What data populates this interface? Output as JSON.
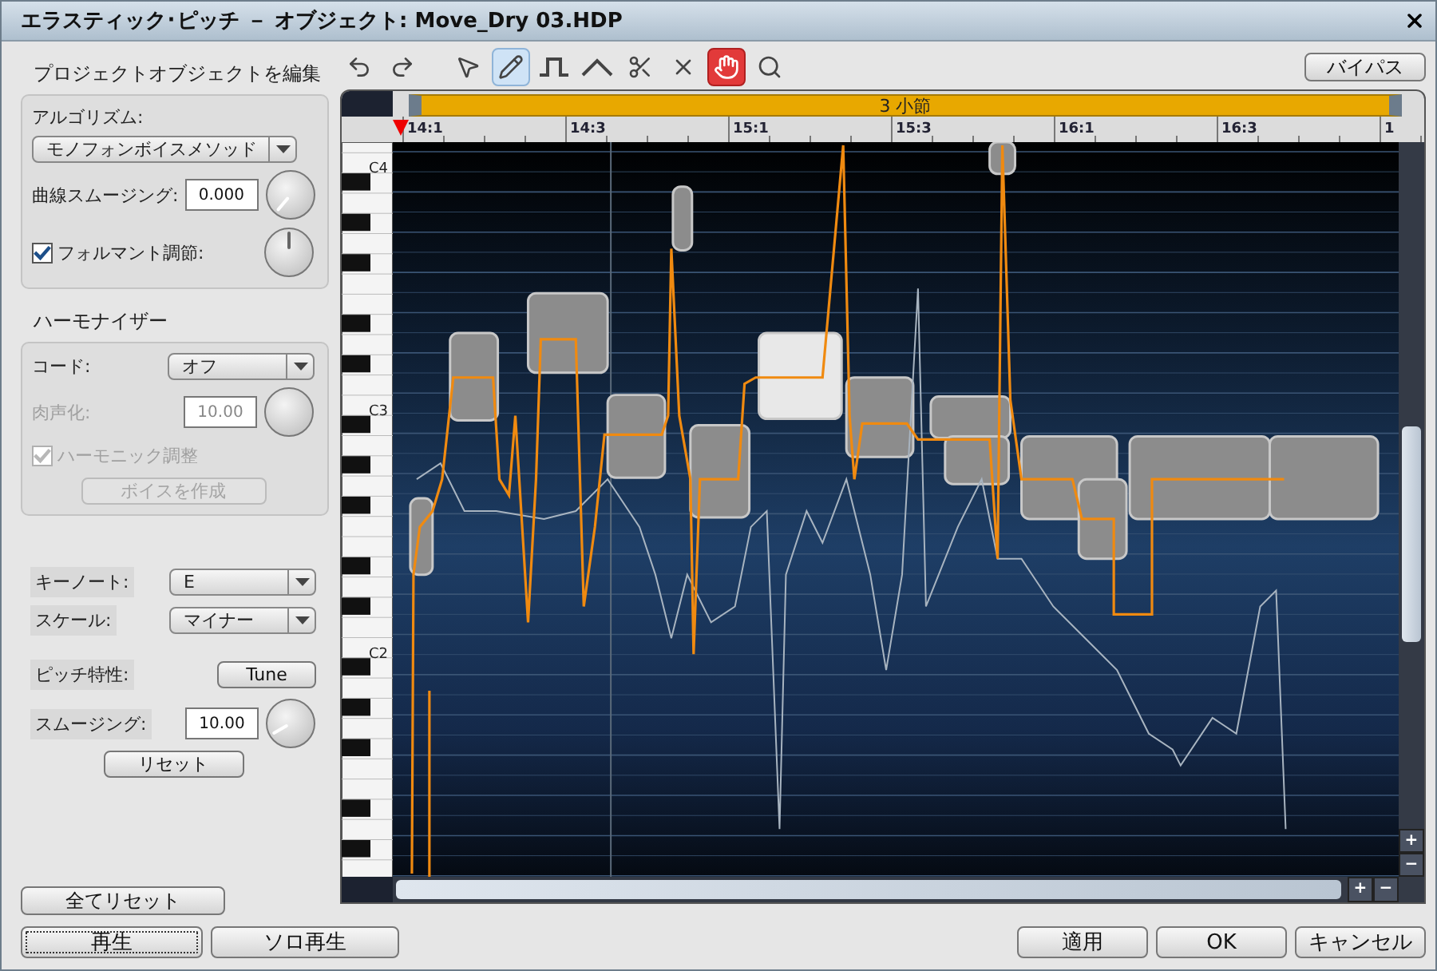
{
  "window": {
    "title": "エラスティック･ピッチ － オブジェクト: Move_Dry 03.HDP"
  },
  "toolbar": {
    "tools": [
      {
        "kind": "undo",
        "selected": false,
        "on": false
      },
      {
        "kind": "redo",
        "selected": false,
        "on": false
      },
      {
        "kind": "pointer",
        "selected": false,
        "on": false
      },
      {
        "kind": "pencil",
        "selected": true,
        "on": false
      },
      {
        "kind": "step",
        "selected": false,
        "on": false
      },
      {
        "kind": "ramp",
        "selected": false,
        "on": false
      },
      {
        "kind": "scissors",
        "selected": false,
        "on": false
      },
      {
        "kind": "delete",
        "selected": false,
        "on": false
      },
      {
        "kind": "hand",
        "selected": false,
        "on": true
      },
      {
        "kind": "zoom",
        "selected": false,
        "on": false
      }
    ],
    "bypass": "バイパス"
  },
  "edit_section": {
    "title": "プロジェクトオブジェクトを編集",
    "algorithm_label": "アルゴリズム:",
    "algorithm": "モノフォンボイスメソッド",
    "curve_smoothing": {
      "label": "曲線スムージング:",
      "value": "0.000"
    },
    "formant": {
      "label": "フォルマント調節:",
      "checked": true
    }
  },
  "harmonizer": {
    "title": "ハーモナイザー",
    "chord_label": "コード:",
    "chord": "オフ",
    "humanize": {
      "label": "肉声化:",
      "value": "10.00",
      "disabled": true
    },
    "harmonic": {
      "label": "ハーモニック調整",
      "checked": true,
      "disabled": true
    },
    "create_voice": {
      "label": "ボイスを作成",
      "disabled": true
    }
  },
  "key": {
    "key_note_label": "キーノート:",
    "key_note": "E",
    "scale_label": "スケール:",
    "scale": "マイナー"
  },
  "pitch": {
    "label": "ピッチ特性:",
    "button": "Tune",
    "smoothing_label": "スムージング:",
    "smoothing": "10.00",
    "reset": "リセット"
  },
  "editor": {
    "region": "3 小節",
    "ruler": [
      "14:1",
      "14:3",
      "15:1",
      "15:3",
      "16:1",
      "16:3",
      "1"
    ],
    "piano_labels": [
      "C4",
      "C3",
      "C2"
    ],
    "vertical_zoom": [
      "+",
      "−"
    ],
    "horizontal_zoom": [
      "+",
      "−"
    ]
  },
  "footer": {
    "reset_all": "全てリセット",
    "play": "再生",
    "solo_play": "ソロ再生",
    "apply": "適用",
    "ok": "OK",
    "cancel": "キャンセル"
  }
}
